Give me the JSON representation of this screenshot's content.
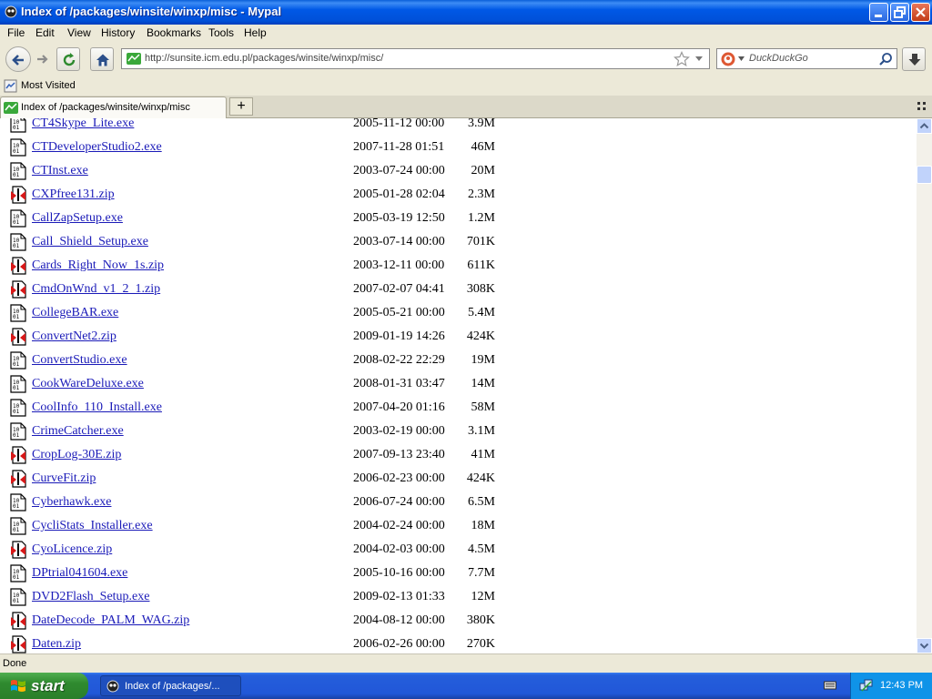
{
  "window": {
    "title": "Index of /packages/winsite/winxp/misc - Mypal"
  },
  "menu": [
    "File",
    "Edit",
    "View",
    "History",
    "Bookmarks",
    "Tools",
    "Help"
  ],
  "toolbar": {
    "url": "http://sunsite.icm.edu.pl/packages/winsite/winxp/misc/",
    "search_placeholder": "DuckDuckGo"
  },
  "bookmarks": {
    "most_visited": "Most Visited"
  },
  "tabs": [
    {
      "label": "Index of /packages/winsite/winxp/misc"
    }
  ],
  "files": [
    {
      "name": "CT4Skype_Lite.exe",
      "date": "2005-11-12 00:00",
      "size": "3.9M",
      "type": "exe"
    },
    {
      "name": "CTDeveloperStudio2.exe",
      "date": "2007-11-28 01:51",
      "size": "46M",
      "type": "exe"
    },
    {
      "name": "CTInst.exe",
      "date": "2003-07-24 00:00",
      "size": "20M",
      "type": "exe"
    },
    {
      "name": "CXPfree131.zip",
      "date": "2005-01-28 02:04",
      "size": "2.3M",
      "type": "zip"
    },
    {
      "name": "CallZapSetup.exe",
      "date": "2005-03-19 12:50",
      "size": "1.2M",
      "type": "exe"
    },
    {
      "name": "Call_Shield_Setup.exe",
      "date": "2003-07-14 00:00",
      "size": "701K",
      "type": "exe"
    },
    {
      "name": "Cards_Right_Now_1s.zip",
      "date": "2003-12-11 00:00",
      "size": "611K",
      "type": "zip"
    },
    {
      "name": "CmdOnWnd_v1_2_1.zip",
      "date": "2007-02-07 04:41",
      "size": "308K",
      "type": "zip"
    },
    {
      "name": "CollegeBAR.exe",
      "date": "2005-05-21 00:00",
      "size": "5.4M",
      "type": "exe"
    },
    {
      "name": "ConvertNet2.zip",
      "date": "2009-01-19 14:26",
      "size": "424K",
      "type": "zip"
    },
    {
      "name": "ConvertStudio.exe",
      "date": "2008-02-22 22:29",
      "size": "19M",
      "type": "exe"
    },
    {
      "name": "CookWareDeluxe.exe",
      "date": "2008-01-31 03:47",
      "size": "14M",
      "type": "exe"
    },
    {
      "name": "CoolInfo_110_Install.exe",
      "date": "2007-04-20 01:16",
      "size": "58M",
      "type": "exe"
    },
    {
      "name": "CrimeCatcher.exe",
      "date": "2003-02-19 00:00",
      "size": "3.1M",
      "type": "exe"
    },
    {
      "name": "CropLog-30E.zip",
      "date": "2007-09-13 23:40",
      "size": "41M",
      "type": "zip"
    },
    {
      "name": "CurveFit.zip",
      "date": "2006-02-23 00:00",
      "size": "424K",
      "type": "zip"
    },
    {
      "name": "Cyberhawk.exe",
      "date": "2006-07-24 00:00",
      "size": "6.5M",
      "type": "exe"
    },
    {
      "name": "CycliStats_Installer.exe",
      "date": "2004-02-24 00:00",
      "size": "18M",
      "type": "exe"
    },
    {
      "name": "CyoLicence.zip",
      "date": "2004-02-03 00:00",
      "size": "4.5M",
      "type": "zip"
    },
    {
      "name": "DPtrial041604.exe",
      "date": "2005-10-16 00:00",
      "size": "7.7M",
      "type": "exe"
    },
    {
      "name": "DVD2Flash_Setup.exe",
      "date": "2009-02-13 01:33",
      "size": "12M",
      "type": "exe"
    },
    {
      "name": "DateDecode_PALM_WAG.zip",
      "date": "2004-08-12 00:00",
      "size": "380K",
      "type": "zip"
    },
    {
      "name": "Daten.zip",
      "date": "2006-02-26 00:00",
      "size": "270K",
      "type": "zip"
    },
    {
      "name": "",
      "date": "",
      "size": "",
      "type": "exe"
    }
  ],
  "status": {
    "text": "Done"
  },
  "taskbar": {
    "start_label": "start",
    "task_label": "Index of /packages/...",
    "clock": "12:43 PM"
  }
}
